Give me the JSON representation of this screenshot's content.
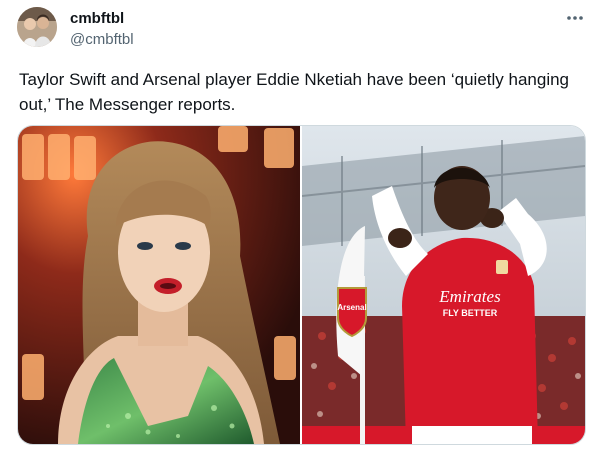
{
  "author": {
    "display_name": "cmbftbl",
    "handle": "@cmbftbl",
    "avatar_icon": "profile-photo"
  },
  "tweet": {
    "text": "Taylor Swift and Arsenal player Eddie Nketiah have been ‘quietly hanging out,’ The Messenger reports.",
    "more_icon": "ellipsis-icon"
  },
  "media": {
    "photos": [
      {
        "subject": "taylor-swift-performing"
      },
      {
        "subject": "arsenal-player-celebrating",
        "shirt_sponsor": "Emirates",
        "shirt_sponsor_line2": "FLY BETTER",
        "badge_text": "Arsenal"
      }
    ]
  },
  "colors": {
    "text_primary": "#0f1419",
    "text_secondary": "#536471",
    "border": "#cfd9de",
    "arsenal_red": "#d7182a"
  }
}
